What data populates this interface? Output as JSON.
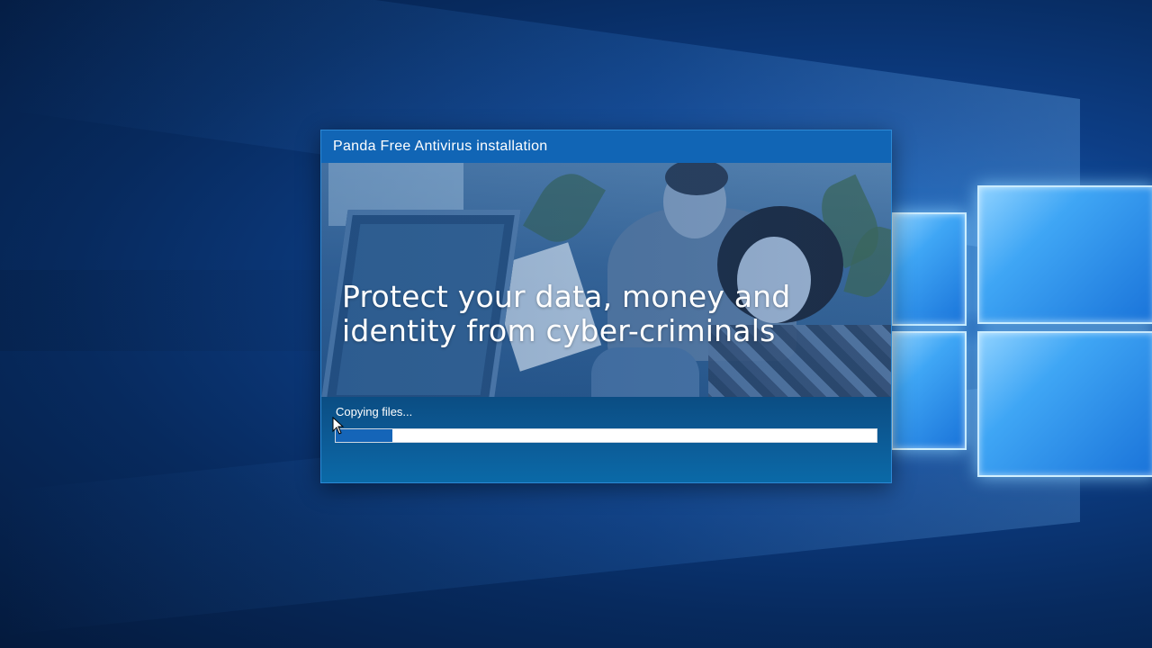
{
  "installer": {
    "title": "Panda Free Antivirus installation",
    "tagline": "Protect your data, money and identity from cyber-criminals",
    "status": "Copying files...",
    "progress_fraction": 0.104
  },
  "colors": {
    "window_title_bg": "#1165b5",
    "progress_fill": "#1565b8",
    "desktop_accent": "#1565c0"
  },
  "icons": {
    "desktop_logo": "windows-logo-icon",
    "pointer": "mouse-cursor-icon"
  }
}
